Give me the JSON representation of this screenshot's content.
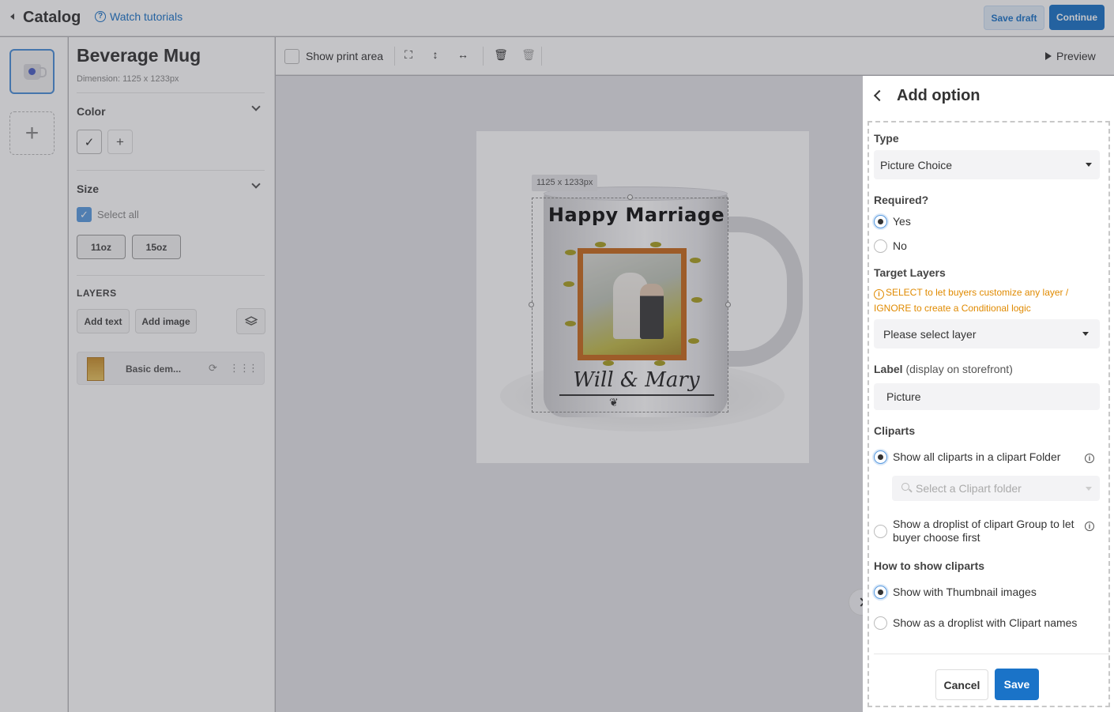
{
  "header": {
    "title": "Catalog",
    "tutorial_link": "Watch tutorials",
    "save_draft": "Save draft",
    "continue": "Continue"
  },
  "product": {
    "name": "Beverage Mug",
    "dimension": "Dimension: 1125 x 1233px"
  },
  "color_section": {
    "title": "Color",
    "add_symbol": "+"
  },
  "size_section": {
    "title": "Size",
    "select_all": "Select all",
    "sizes": [
      "11oz",
      "15oz"
    ]
  },
  "layers_section": {
    "title": "LAYERS",
    "add_text": "Add text",
    "add_image": "Add image",
    "layer_name": "Basic dem..."
  },
  "toolbar": {
    "show_print_area": "Show print area",
    "preview": "Preview"
  },
  "canvas": {
    "size_tag": "1125 x 1233px",
    "mug_heading": "Happy Marriage",
    "mug_script": "Will & Mary"
  },
  "add_option": {
    "title": "Add option",
    "type_label": "Type",
    "type_value": "Picture Choice",
    "required_label": "Required?",
    "required_yes": "Yes",
    "required_no": "No",
    "target_layers_label": "Target Layers",
    "target_layers_hint": "SELECT to let buyers customize any layer / IGNORE to create a Conditional logic",
    "target_layers_value": "Please select layer",
    "label_label": "Label",
    "label_sub": "(display on storefront)",
    "label_value": "Picture",
    "cliparts_label": "Cliparts",
    "clip_opt_folder": "Show all cliparts in a clipart Folder",
    "clip_folder_placeholder": "Select a Clipart folder",
    "clip_opt_group": "Show a droplist of clipart Group to let buyer choose first",
    "how_label": "How to show cliparts",
    "how_thumb": "Show with Thumbnail images",
    "how_droplist": "Show as a droplist with Clipart names",
    "cancel": "Cancel",
    "save": "Save"
  },
  "colors": {
    "primary": "#1a73c8",
    "warning": "#e08a00"
  }
}
